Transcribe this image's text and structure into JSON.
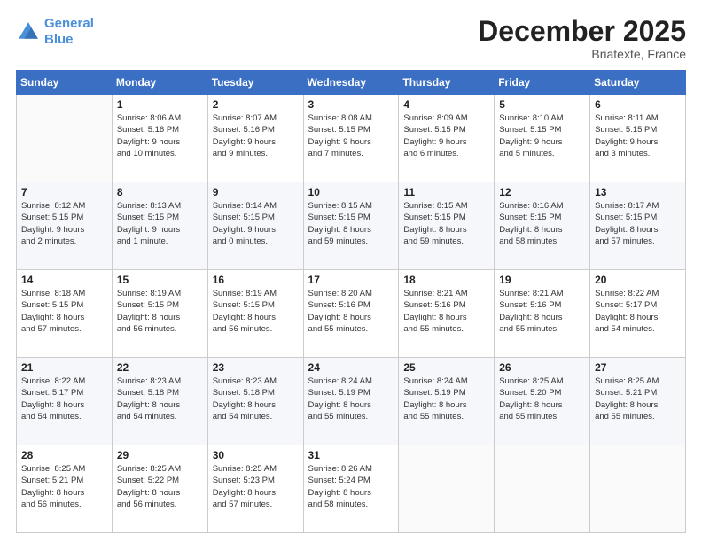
{
  "logo": {
    "line1": "General",
    "line2": "Blue"
  },
  "header": {
    "month": "December 2025",
    "location": "Briatexte, France"
  },
  "weekdays": [
    "Sunday",
    "Monday",
    "Tuesday",
    "Wednesday",
    "Thursday",
    "Friday",
    "Saturday"
  ],
  "weeks": [
    [
      {
        "day": "",
        "info": ""
      },
      {
        "day": "1",
        "info": "Sunrise: 8:06 AM\nSunset: 5:16 PM\nDaylight: 9 hours\nand 10 minutes."
      },
      {
        "day": "2",
        "info": "Sunrise: 8:07 AM\nSunset: 5:16 PM\nDaylight: 9 hours\nand 9 minutes."
      },
      {
        "day": "3",
        "info": "Sunrise: 8:08 AM\nSunset: 5:15 PM\nDaylight: 9 hours\nand 7 minutes."
      },
      {
        "day": "4",
        "info": "Sunrise: 8:09 AM\nSunset: 5:15 PM\nDaylight: 9 hours\nand 6 minutes."
      },
      {
        "day": "5",
        "info": "Sunrise: 8:10 AM\nSunset: 5:15 PM\nDaylight: 9 hours\nand 5 minutes."
      },
      {
        "day": "6",
        "info": "Sunrise: 8:11 AM\nSunset: 5:15 PM\nDaylight: 9 hours\nand 3 minutes."
      }
    ],
    [
      {
        "day": "7",
        "info": "Sunrise: 8:12 AM\nSunset: 5:15 PM\nDaylight: 9 hours\nand 2 minutes."
      },
      {
        "day": "8",
        "info": "Sunrise: 8:13 AM\nSunset: 5:15 PM\nDaylight: 9 hours\nand 1 minute."
      },
      {
        "day": "9",
        "info": "Sunrise: 8:14 AM\nSunset: 5:15 PM\nDaylight: 9 hours\nand 0 minutes."
      },
      {
        "day": "10",
        "info": "Sunrise: 8:15 AM\nSunset: 5:15 PM\nDaylight: 8 hours\nand 59 minutes."
      },
      {
        "day": "11",
        "info": "Sunrise: 8:15 AM\nSunset: 5:15 PM\nDaylight: 8 hours\nand 59 minutes."
      },
      {
        "day": "12",
        "info": "Sunrise: 8:16 AM\nSunset: 5:15 PM\nDaylight: 8 hours\nand 58 minutes."
      },
      {
        "day": "13",
        "info": "Sunrise: 8:17 AM\nSunset: 5:15 PM\nDaylight: 8 hours\nand 57 minutes."
      }
    ],
    [
      {
        "day": "14",
        "info": "Sunrise: 8:18 AM\nSunset: 5:15 PM\nDaylight: 8 hours\nand 57 minutes."
      },
      {
        "day": "15",
        "info": "Sunrise: 8:19 AM\nSunset: 5:15 PM\nDaylight: 8 hours\nand 56 minutes."
      },
      {
        "day": "16",
        "info": "Sunrise: 8:19 AM\nSunset: 5:15 PM\nDaylight: 8 hours\nand 56 minutes."
      },
      {
        "day": "17",
        "info": "Sunrise: 8:20 AM\nSunset: 5:16 PM\nDaylight: 8 hours\nand 55 minutes."
      },
      {
        "day": "18",
        "info": "Sunrise: 8:21 AM\nSunset: 5:16 PM\nDaylight: 8 hours\nand 55 minutes."
      },
      {
        "day": "19",
        "info": "Sunrise: 8:21 AM\nSunset: 5:16 PM\nDaylight: 8 hours\nand 55 minutes."
      },
      {
        "day": "20",
        "info": "Sunrise: 8:22 AM\nSunset: 5:17 PM\nDaylight: 8 hours\nand 54 minutes."
      }
    ],
    [
      {
        "day": "21",
        "info": "Sunrise: 8:22 AM\nSunset: 5:17 PM\nDaylight: 8 hours\nand 54 minutes."
      },
      {
        "day": "22",
        "info": "Sunrise: 8:23 AM\nSunset: 5:18 PM\nDaylight: 8 hours\nand 54 minutes."
      },
      {
        "day": "23",
        "info": "Sunrise: 8:23 AM\nSunset: 5:18 PM\nDaylight: 8 hours\nand 54 minutes."
      },
      {
        "day": "24",
        "info": "Sunrise: 8:24 AM\nSunset: 5:19 PM\nDaylight: 8 hours\nand 55 minutes."
      },
      {
        "day": "25",
        "info": "Sunrise: 8:24 AM\nSunset: 5:19 PM\nDaylight: 8 hours\nand 55 minutes."
      },
      {
        "day": "26",
        "info": "Sunrise: 8:25 AM\nSunset: 5:20 PM\nDaylight: 8 hours\nand 55 minutes."
      },
      {
        "day": "27",
        "info": "Sunrise: 8:25 AM\nSunset: 5:21 PM\nDaylight: 8 hours\nand 55 minutes."
      }
    ],
    [
      {
        "day": "28",
        "info": "Sunrise: 8:25 AM\nSunset: 5:21 PM\nDaylight: 8 hours\nand 56 minutes."
      },
      {
        "day": "29",
        "info": "Sunrise: 8:25 AM\nSunset: 5:22 PM\nDaylight: 8 hours\nand 56 minutes."
      },
      {
        "day": "30",
        "info": "Sunrise: 8:25 AM\nSunset: 5:23 PM\nDaylight: 8 hours\nand 57 minutes."
      },
      {
        "day": "31",
        "info": "Sunrise: 8:26 AM\nSunset: 5:24 PM\nDaylight: 8 hours\nand 58 minutes."
      },
      {
        "day": "",
        "info": ""
      },
      {
        "day": "",
        "info": ""
      },
      {
        "day": "",
        "info": ""
      }
    ]
  ]
}
